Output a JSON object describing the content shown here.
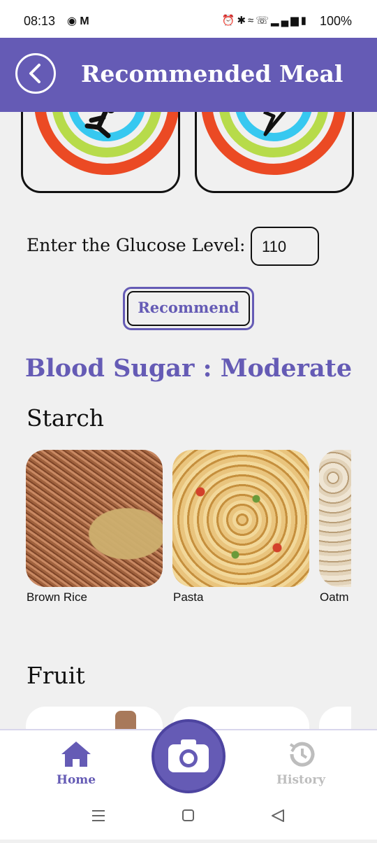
{
  "status_bar": {
    "time": "08:13",
    "left_icons": [
      "timer-icon",
      "gmail-icon"
    ],
    "right_icons": [
      "alarm-icon",
      "bluetooth-icon",
      "wifi-icon",
      "wifi-calling-icon",
      "signal-icon",
      "battery-icon"
    ],
    "battery": "100%"
  },
  "app_bar": {
    "title": "Recommended Meal",
    "back_icon": "back-circle-icon",
    "background": "#655bb5"
  },
  "activity_cards": [
    {
      "icon": "running-figure-icon",
      "ring_colors": [
        "#eb4a24",
        "#b7db4a",
        "#37c8f0"
      ]
    },
    {
      "icon": "lightning-icon",
      "ring_colors": [
        "#eb4a24",
        "#b7db4a",
        "#37c8f0"
      ]
    }
  ],
  "glucose": {
    "label": "Enter the Glucose Level:",
    "value": "110"
  },
  "recommend_button": {
    "label": "Recommend"
  },
  "result": {
    "text": "Blood Sugar : Moderate",
    "color": "#655bb5"
  },
  "sections": [
    {
      "title": "Starch",
      "items": [
        {
          "name": "Brown Rice"
        },
        {
          "name": "Pasta"
        },
        {
          "name": "Oatm"
        }
      ]
    },
    {
      "title": "Fruit",
      "items": []
    }
  ],
  "bottom_nav": {
    "home_label": "Home",
    "history_label": "History",
    "camera_icon": "camera-icon",
    "active_color": "#655bb5",
    "inactive_color": "#bdbdbd"
  },
  "system_nav": {
    "icons": [
      "recents-icon",
      "home-square-icon",
      "back-triangle-icon"
    ]
  }
}
